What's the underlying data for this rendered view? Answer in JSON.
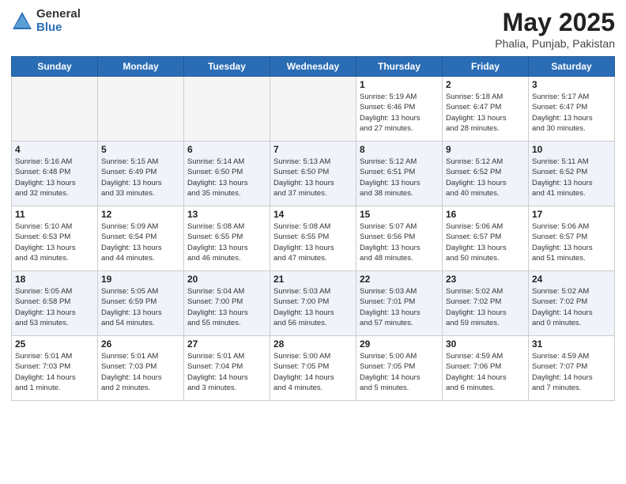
{
  "header": {
    "logo_general": "General",
    "logo_blue": "Blue",
    "title": "May 2025",
    "location": "Phalia, Punjab, Pakistan"
  },
  "days_of_week": [
    "Sunday",
    "Monday",
    "Tuesday",
    "Wednesday",
    "Thursday",
    "Friday",
    "Saturday"
  ],
  "weeks": [
    [
      {
        "day": "",
        "info": ""
      },
      {
        "day": "",
        "info": ""
      },
      {
        "day": "",
        "info": ""
      },
      {
        "day": "",
        "info": ""
      },
      {
        "day": "1",
        "info": "Sunrise: 5:19 AM\nSunset: 6:46 PM\nDaylight: 13 hours\nand 27 minutes."
      },
      {
        "day": "2",
        "info": "Sunrise: 5:18 AM\nSunset: 6:47 PM\nDaylight: 13 hours\nand 28 minutes."
      },
      {
        "day": "3",
        "info": "Sunrise: 5:17 AM\nSunset: 6:47 PM\nDaylight: 13 hours\nand 30 minutes."
      }
    ],
    [
      {
        "day": "4",
        "info": "Sunrise: 5:16 AM\nSunset: 6:48 PM\nDaylight: 13 hours\nand 32 minutes."
      },
      {
        "day": "5",
        "info": "Sunrise: 5:15 AM\nSunset: 6:49 PM\nDaylight: 13 hours\nand 33 minutes."
      },
      {
        "day": "6",
        "info": "Sunrise: 5:14 AM\nSunset: 6:50 PM\nDaylight: 13 hours\nand 35 minutes."
      },
      {
        "day": "7",
        "info": "Sunrise: 5:13 AM\nSunset: 6:50 PM\nDaylight: 13 hours\nand 37 minutes."
      },
      {
        "day": "8",
        "info": "Sunrise: 5:12 AM\nSunset: 6:51 PM\nDaylight: 13 hours\nand 38 minutes."
      },
      {
        "day": "9",
        "info": "Sunrise: 5:12 AM\nSunset: 6:52 PM\nDaylight: 13 hours\nand 40 minutes."
      },
      {
        "day": "10",
        "info": "Sunrise: 5:11 AM\nSunset: 6:52 PM\nDaylight: 13 hours\nand 41 minutes."
      }
    ],
    [
      {
        "day": "11",
        "info": "Sunrise: 5:10 AM\nSunset: 6:53 PM\nDaylight: 13 hours\nand 43 minutes."
      },
      {
        "day": "12",
        "info": "Sunrise: 5:09 AM\nSunset: 6:54 PM\nDaylight: 13 hours\nand 44 minutes."
      },
      {
        "day": "13",
        "info": "Sunrise: 5:08 AM\nSunset: 6:55 PM\nDaylight: 13 hours\nand 46 minutes."
      },
      {
        "day": "14",
        "info": "Sunrise: 5:08 AM\nSunset: 6:55 PM\nDaylight: 13 hours\nand 47 minutes."
      },
      {
        "day": "15",
        "info": "Sunrise: 5:07 AM\nSunset: 6:56 PM\nDaylight: 13 hours\nand 48 minutes."
      },
      {
        "day": "16",
        "info": "Sunrise: 5:06 AM\nSunset: 6:57 PM\nDaylight: 13 hours\nand 50 minutes."
      },
      {
        "day": "17",
        "info": "Sunrise: 5:06 AM\nSunset: 6:57 PM\nDaylight: 13 hours\nand 51 minutes."
      }
    ],
    [
      {
        "day": "18",
        "info": "Sunrise: 5:05 AM\nSunset: 6:58 PM\nDaylight: 13 hours\nand 53 minutes."
      },
      {
        "day": "19",
        "info": "Sunrise: 5:05 AM\nSunset: 6:59 PM\nDaylight: 13 hours\nand 54 minutes."
      },
      {
        "day": "20",
        "info": "Sunrise: 5:04 AM\nSunset: 7:00 PM\nDaylight: 13 hours\nand 55 minutes."
      },
      {
        "day": "21",
        "info": "Sunrise: 5:03 AM\nSunset: 7:00 PM\nDaylight: 13 hours\nand 56 minutes."
      },
      {
        "day": "22",
        "info": "Sunrise: 5:03 AM\nSunset: 7:01 PM\nDaylight: 13 hours\nand 57 minutes."
      },
      {
        "day": "23",
        "info": "Sunrise: 5:02 AM\nSunset: 7:02 PM\nDaylight: 13 hours\nand 59 minutes."
      },
      {
        "day": "24",
        "info": "Sunrise: 5:02 AM\nSunset: 7:02 PM\nDaylight: 14 hours\nand 0 minutes."
      }
    ],
    [
      {
        "day": "25",
        "info": "Sunrise: 5:01 AM\nSunset: 7:03 PM\nDaylight: 14 hours\nand 1 minute."
      },
      {
        "day": "26",
        "info": "Sunrise: 5:01 AM\nSunset: 7:03 PM\nDaylight: 14 hours\nand 2 minutes."
      },
      {
        "day": "27",
        "info": "Sunrise: 5:01 AM\nSunset: 7:04 PM\nDaylight: 14 hours\nand 3 minutes."
      },
      {
        "day": "28",
        "info": "Sunrise: 5:00 AM\nSunset: 7:05 PM\nDaylight: 14 hours\nand 4 minutes."
      },
      {
        "day": "29",
        "info": "Sunrise: 5:00 AM\nSunset: 7:05 PM\nDaylight: 14 hours\nand 5 minutes."
      },
      {
        "day": "30",
        "info": "Sunrise: 4:59 AM\nSunset: 7:06 PM\nDaylight: 14 hours\nand 6 minutes."
      },
      {
        "day": "31",
        "info": "Sunrise: 4:59 AM\nSunset: 7:07 PM\nDaylight: 14 hours\nand 7 minutes."
      }
    ]
  ]
}
